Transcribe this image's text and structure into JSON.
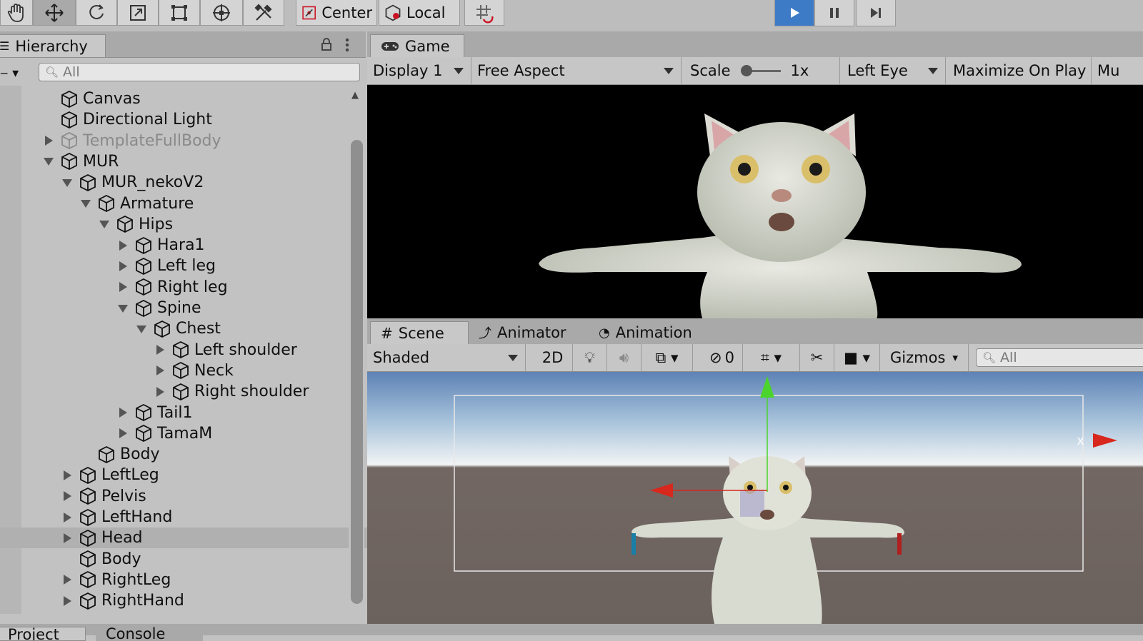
{
  "toolbar": {
    "pivot_label": "Center",
    "space_label": "Local"
  },
  "hierarchy": {
    "tab_label": "Hierarchy",
    "search_placeholder": "All",
    "rows": [
      {
        "label": "Canvas"
      },
      {
        "label": "Directional Light"
      },
      {
        "label": "TemplateFullBody"
      },
      {
        "label": "MUR"
      },
      {
        "label": "MUR_nekoV2"
      },
      {
        "label": "Armature"
      },
      {
        "label": "Hips"
      },
      {
        "label": "Hara1"
      },
      {
        "label": "Left leg"
      },
      {
        "label": "Right leg"
      },
      {
        "label": "Spine"
      },
      {
        "label": "Chest"
      },
      {
        "label": "Left shoulder"
      },
      {
        "label": "Neck"
      },
      {
        "label": "Right shoulder"
      },
      {
        "label": "Tail1"
      },
      {
        "label": "TamaM"
      },
      {
        "label": "Body"
      },
      {
        "label": "LeftLeg"
      },
      {
        "label": "Pelvis"
      },
      {
        "label": "LeftHand"
      },
      {
        "label": "Head"
      },
      {
        "label": "Body"
      },
      {
        "label": "RightLeg"
      },
      {
        "label": "RightHand"
      }
    ]
  },
  "game": {
    "tab_label": "Game",
    "display": "Display 1",
    "aspect": "Free Aspect",
    "scale_label": "Scale",
    "scale_value": "1x",
    "eye": "Left Eye",
    "maximize": "Maximize On Play",
    "mute": "Mu"
  },
  "scene": {
    "tabs": [
      "Scene",
      "Animator",
      "Animation"
    ],
    "shading": "Shaded",
    "mode_2d": "2D",
    "hidden_count": "0",
    "gizmos": "Gizmos",
    "search_placeholder": "All",
    "axis_label": "x"
  },
  "bottom": {
    "tabs": [
      "Project",
      "Console"
    ]
  },
  "colors": {
    "play_active": "#3d7bc6",
    "gizmo_red": "#d8271c",
    "gizmo_green": "#4bd42b"
  }
}
